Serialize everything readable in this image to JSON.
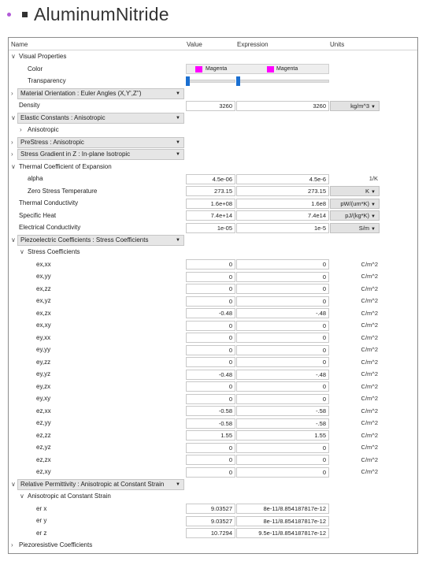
{
  "title": "AluminumNitride",
  "columns": {
    "name": "Name",
    "value": "Value",
    "expression": "Expression",
    "units": "Units"
  },
  "visual": {
    "label": "Visual Properties",
    "color_label": "Color",
    "color_value": "Magenta",
    "color_expr": "Magenta",
    "color_hex": "#ff00ff",
    "transparency_label": "Transparency"
  },
  "material_orientation": "Material Orientation : Euler Angles (X,Y',Z'')",
  "density": {
    "label": "Density",
    "value": "3260",
    "expr": "3260",
    "unit": "kg/m^3"
  },
  "elastic": {
    "label": "Elastic Constants : Anisotropic",
    "child": "Anisotropic"
  },
  "prestress": "PreStress : Anisotropic",
  "stress_gradient": "Stress Gradient in Z : In-plane Isotropic",
  "thermal_coef": {
    "label": "Thermal Coefficient of Expansion",
    "alpha": {
      "label": "alpha",
      "value": "4.5e-06",
      "expr": "4.5e-6",
      "unit": "1/K"
    },
    "zst": {
      "label": "Zero Stress Temperature",
      "value": "273.15",
      "expr": "273.15",
      "unit": "K"
    }
  },
  "thermal_conductivity": {
    "label": "Thermal Conductivity",
    "value": "1.6e+08",
    "expr": "1.6e8",
    "unit": "pW/(um*K)"
  },
  "specific_heat": {
    "label": "Specific Heat",
    "value": "7.4e+14",
    "expr": "7.4e14",
    "unit": "pJ/(kg*K)"
  },
  "electrical_conductivity": {
    "label": "Electrical Conductivity",
    "value": "1e-05",
    "expr": "1e-5",
    "unit": "S/m"
  },
  "piezo": {
    "label": "Piezoelectric Coefficients : Stress Coefficients",
    "sub_label": "Stress Coefficients",
    "rows": [
      {
        "label": "ex,xx",
        "value": "0",
        "expr": "0",
        "unit": "C/m^2"
      },
      {
        "label": "ex,yy",
        "value": "0",
        "expr": "0",
        "unit": "C/m^2"
      },
      {
        "label": "ex,zz",
        "value": "0",
        "expr": "0",
        "unit": "C/m^2"
      },
      {
        "label": "ex,yz",
        "value": "0",
        "expr": "0",
        "unit": "C/m^2"
      },
      {
        "label": "ex,zx",
        "value": "-0.48",
        "expr": "-.48",
        "unit": "C/m^2"
      },
      {
        "label": "ex,xy",
        "value": "0",
        "expr": "0",
        "unit": "C/m^2"
      },
      {
        "label": "ey,xx",
        "value": "0",
        "expr": "0",
        "unit": "C/m^2"
      },
      {
        "label": "ey,yy",
        "value": "0",
        "expr": "0",
        "unit": "C/m^2"
      },
      {
        "label": "ey,zz",
        "value": "0",
        "expr": "0",
        "unit": "C/m^2"
      },
      {
        "label": "ey,yz",
        "value": "-0.48",
        "expr": "-.48",
        "unit": "C/m^2"
      },
      {
        "label": "ey,zx",
        "value": "0",
        "expr": "0",
        "unit": "C/m^2"
      },
      {
        "label": "ey,xy",
        "value": "0",
        "expr": "0",
        "unit": "C/m^2"
      },
      {
        "label": "ez,xx",
        "value": "-0.58",
        "expr": "-.58",
        "unit": "C/m^2"
      },
      {
        "label": "ez,yy",
        "value": "-0.58",
        "expr": "-.58",
        "unit": "C/m^2"
      },
      {
        "label": "ez,zz",
        "value": "1.55",
        "expr": "1.55",
        "unit": "C/m^2"
      },
      {
        "label": "ez,yz",
        "value": "0",
        "expr": "0",
        "unit": "C/m^2"
      },
      {
        "label": "ez,zx",
        "value": "0",
        "expr": "0",
        "unit": "C/m^2"
      },
      {
        "label": "ez,xy",
        "value": "0",
        "expr": "0",
        "unit": "C/m^2"
      }
    ]
  },
  "permittivity": {
    "label": "Relative Permittivity : Anisotropic at Constant Strain",
    "sub_label": "Anisotropic at Constant Strain",
    "rows": [
      {
        "label": "er x",
        "value": "9.03527",
        "expr": "8e-11/8.854187817e-12"
      },
      {
        "label": "er y",
        "value": "9.03527",
        "expr": "8e-11/8.854187817e-12"
      },
      {
        "label": "er z",
        "value": "10.7294",
        "expr": "9.5e-11/8.854187817e-12"
      }
    ]
  },
  "piezoresistive": "Piezoresistive Coefficients"
}
